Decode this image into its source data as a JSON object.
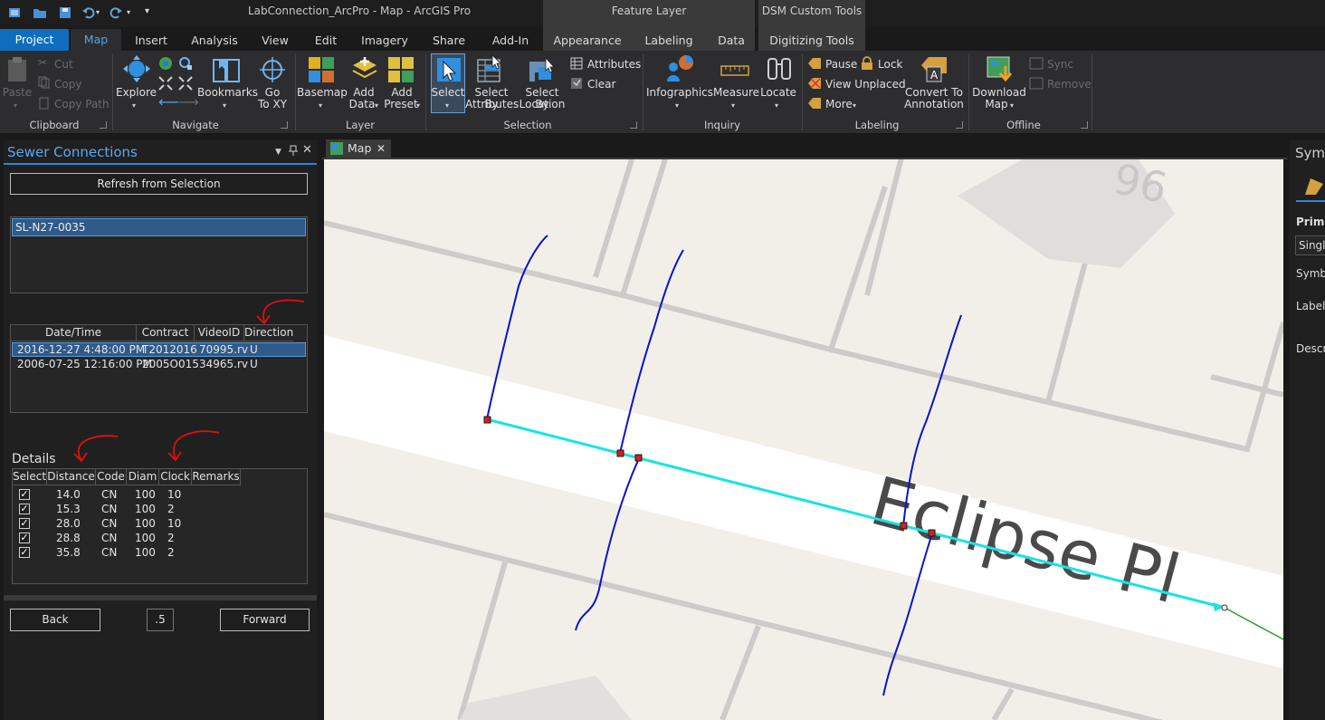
{
  "title": "LabConnection_ArcPro - Map - ArcGIS Pro",
  "contextual_tabs": {
    "feature_layer": "Feature Layer",
    "dsm": "DSM Custom Tools"
  },
  "tabs": [
    "Project",
    "Map",
    "Insert",
    "Analysis",
    "View",
    "Edit",
    "Imagery",
    "Share",
    "Add-In",
    "Appearance",
    "Labeling",
    "Data",
    "Digitizing Tools"
  ],
  "ribbon": {
    "clipboard": {
      "label": "Clipboard",
      "paste": "Paste",
      "cut": "Cut",
      "copy": "Copy",
      "copy_path": "Copy Path"
    },
    "navigate": {
      "label": "Navigate",
      "explore": "Explore",
      "bookmarks": "Bookmarks",
      "go_to_xy_1": "Go",
      "go_to_xy_2": "To XY"
    },
    "layer": {
      "label": "Layer",
      "basemap": "Basemap",
      "add_data_1": "Add",
      "add_data_2": "Data",
      "add_preset_1": "Add",
      "add_preset_2": "Preset"
    },
    "selection": {
      "label": "Selection",
      "select": "Select",
      "by_attr_1": "Select By",
      "by_attr_2": "Attributes",
      "by_loc_1": "Select By",
      "by_loc_2": "Location",
      "attributes": "Attributes",
      "clear": "Clear"
    },
    "inquiry": {
      "label": "Inquiry",
      "infographics": "Infographics",
      "measure": "Measure",
      "locate": "Locate"
    },
    "labeling": {
      "label": "Labeling",
      "pause": "Pause",
      "lock": "Lock",
      "view_unplaced": "View Unplaced",
      "more": "More",
      "convert_1": "Convert To",
      "convert_2": "Annotation"
    },
    "offline": {
      "label": "Offline",
      "download_1": "Download",
      "download_2": "Map",
      "sync": "Sync",
      "remove": "Remove"
    }
  },
  "pane": {
    "title": "Sewer Connections",
    "refresh_button": "Refresh from Selection",
    "list_item": "SL-N27-0035",
    "video_columns": [
      "Date/Time",
      "Contract",
      "VideoID",
      "Direction"
    ],
    "video_rows": [
      [
        "2016-12-27 4:48:00 PM",
        "T2012016",
        "70995.rv",
        "U"
      ],
      [
        "2006-07-25 12:16:00 PM",
        "2005O015",
        "34965.rv",
        "U"
      ]
    ],
    "details_label": "Details",
    "detail_columns": [
      "Select",
      "Distance",
      "Code",
      "Diam",
      "Clock",
      "Remarks"
    ],
    "detail_rows": [
      [
        "14.0",
        "CN",
        "100",
        "10"
      ],
      [
        "15.3",
        "CN",
        "100",
        "2"
      ],
      [
        "28.0",
        "CN",
        "100",
        "10"
      ],
      [
        "28.8",
        "CN",
        "100",
        "2"
      ],
      [
        "35.8",
        "CN",
        "100",
        "2"
      ]
    ],
    "check_mark": "✓",
    "back_button": "Back",
    "step_value": ".5",
    "forward_button": "Forward"
  },
  "map": {
    "tab_label": "Map",
    "street_label": "Eclipse Pl",
    "parcel_number": "96"
  },
  "right_pane": {
    "title": "Symb",
    "primary": "Prima",
    "single": "Single",
    "symbol": "Symbo",
    "label": "Label",
    "description": "Descri"
  },
  "colors": {
    "accent": "#0e6ebd",
    "lateral": "#0a14c8",
    "main_line": "#19e3e3",
    "vertex": "#d81e1e",
    "annotation": "#e01010"
  }
}
